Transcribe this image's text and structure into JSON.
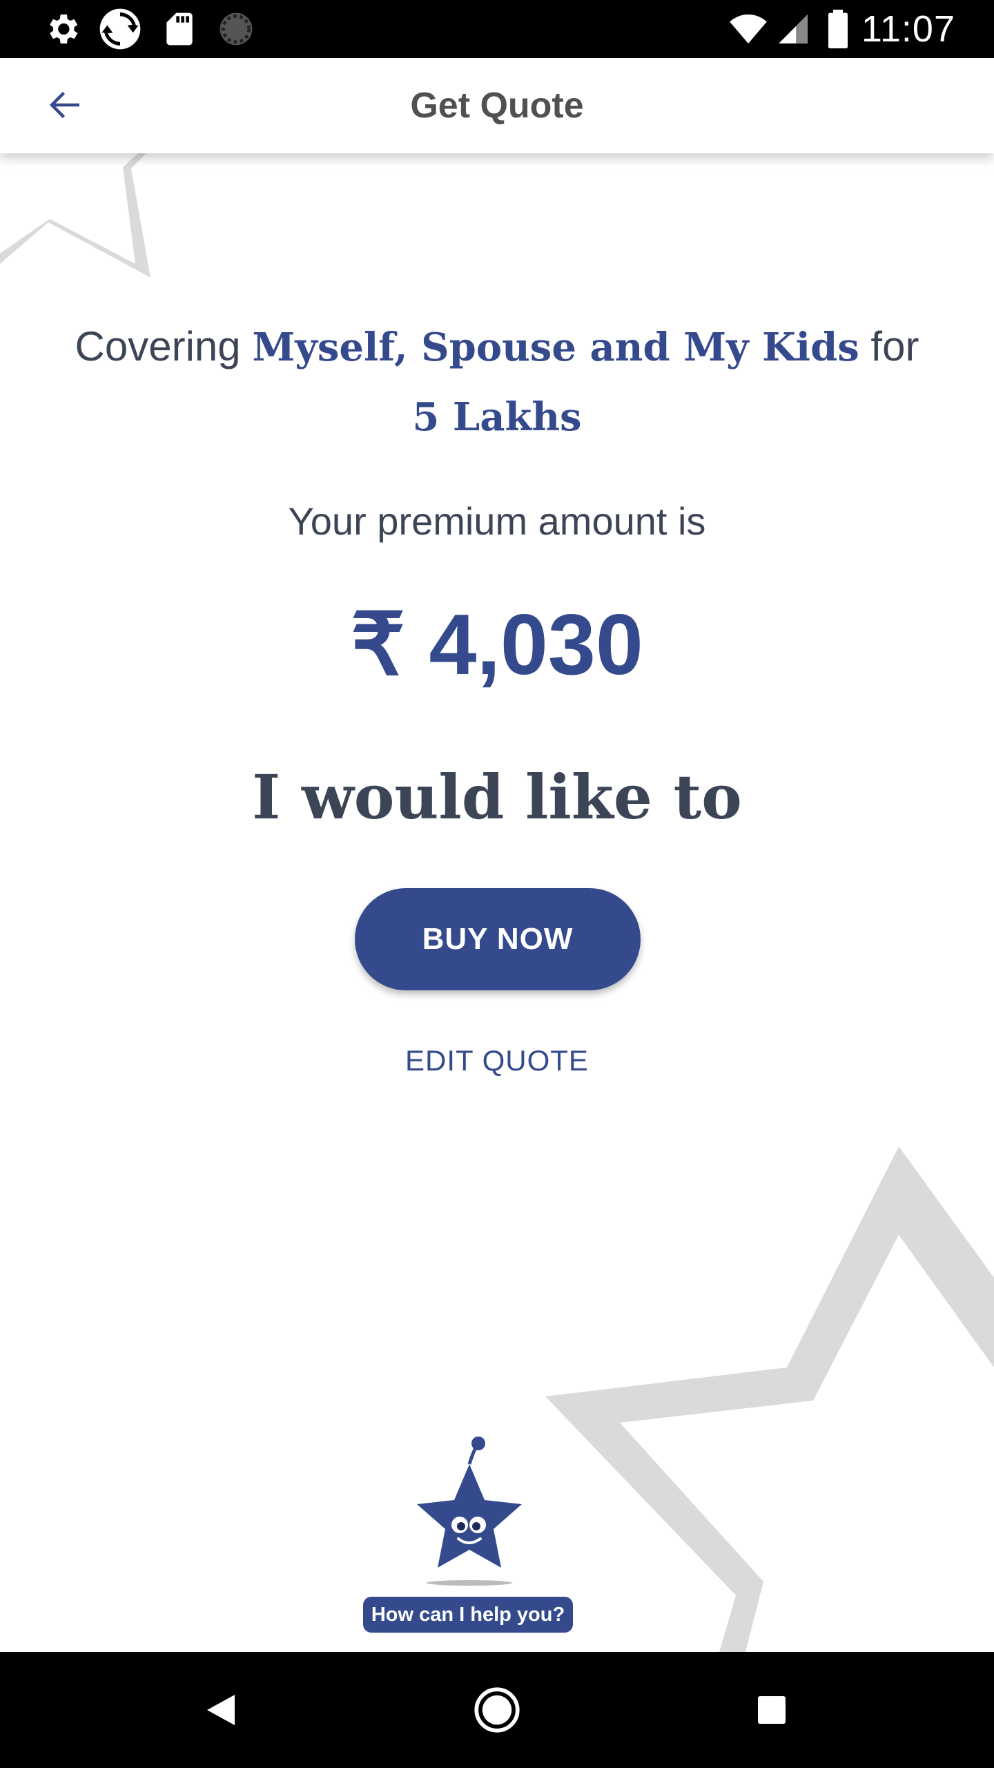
{
  "status_bar": {
    "time": "11:07",
    "icons": [
      "settings-icon",
      "sync-icon",
      "sd-card-icon",
      "loading-icon",
      "wifi-icon",
      "signal-icon",
      "battery-icon"
    ]
  },
  "app_bar": {
    "title": "Get Quote",
    "back_icon": "arrow-back-icon"
  },
  "quote": {
    "coverage_prefix": "Covering ",
    "members": "Myself, Spouse and My Kids",
    "coverage_mid": " for ",
    "sum_insured": "5 Lakhs",
    "premium_label": "Your premium amount is",
    "premium_amount": "₹ 4,030",
    "action_heading": "I would like to"
  },
  "actions": {
    "buy_label": "BUY NOW",
    "edit_label": "EDIT QUOTE"
  },
  "help": {
    "label": "How can I help you?"
  },
  "nav_bar": {
    "icons": [
      "back-triangle-icon",
      "home-circle-icon",
      "recents-square-icon"
    ]
  },
  "colors": {
    "brand": "#344a8c",
    "text_dark": "#3c4556",
    "star_watermark": "#dadada",
    "status_bar": "#000000"
  }
}
